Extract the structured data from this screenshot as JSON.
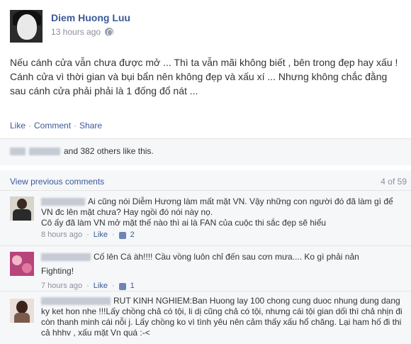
{
  "post": {
    "author": "Diem Huong Luu",
    "timestamp": "13 hours ago",
    "privacy_icon": "globe-icon",
    "text": "Nếu cánh cửa vẫn chưa được mở ... Thì ta vẫn mãi không biết , bên trong đẹp hay xấu ! Cánh cửa vì thời gian và bụi bẩn nên không đẹp và xấu xí ... Nhưng không chắc đằng sau cánh cửa phải phải là 1 đống đổ nát ..."
  },
  "actions": {
    "like": "Like",
    "comment": "Comment",
    "share": "Share",
    "separator": "·"
  },
  "likes": {
    "text": "and 382 others like this."
  },
  "comments_header": {
    "view_previous": "View previous comments",
    "count": "4 of 59"
  },
  "comments": [
    {
      "text": "Ai cũng nói Diễm Hương làm mất mặt VN. Vậy những con người đó đã làm gì để VN đc lên mặt chưa? Hay ngồi đó nói này nọ.",
      "text2": "Cô ấy đã làm VN mở mặt thế nào thì ai là FAN của cuộc thi sắc đẹp sẽ hiểu",
      "time": "8 hours ago",
      "like_label": "Like",
      "like_count": "2"
    },
    {
      "text": "Cố lên Cá àh!!!! Cầu vồng luôn chỉ đến sau cơn mưa.... Ko gì phải nản",
      "text2": "Fighting!",
      "time": "7 hours ago",
      "like_label": "Like",
      "like_count": "1"
    },
    {
      "text": "RUT KINH NGHIEM:Ban Huong lay 100 chong cung duoc nhung dung dang ky ket hon nhe !!!Lấy chồng chả có tội, li dị cũng chả có tội, nhưng cái tội gian dối thì chả nhịn đi còn thanh minh cái nỗi j. Lấy chồng ko vì tình yêu nên cảm thấy xấu hổ chăng. Lại ham hố đi thi cả hhhv , xấu mặt Vn quá :-<"
    }
  ]
}
